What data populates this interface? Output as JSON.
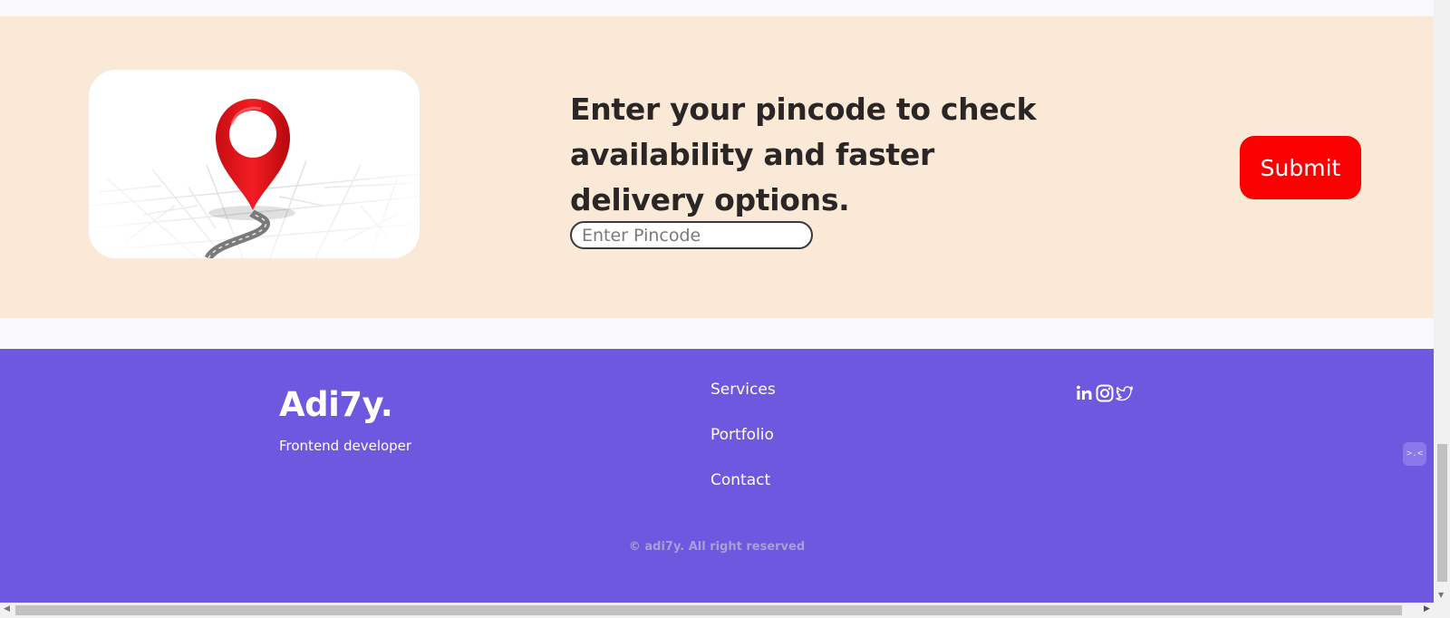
{
  "pincode": {
    "heading": "Enter your pincode to check availability and faster delivery options.",
    "input_placeholder": "Enter Pincode",
    "input_value": "",
    "submit_label": "Submit"
  },
  "footer": {
    "brand": "Adi7y.",
    "tagline": "Frontend developer",
    "links": [
      "Services",
      "Portfolio",
      "Contact"
    ],
    "socials": [
      "linkedin-icon",
      "instagram-icon",
      "twitter-icon"
    ],
    "copyright": "© adi7y. All right reserved"
  },
  "colors": {
    "pin_section_bg": "#f9e9d6",
    "submit_bg": "#fb0000",
    "footer_bg": "#6e58e0",
    "map_pin": "#e8141b"
  }
}
